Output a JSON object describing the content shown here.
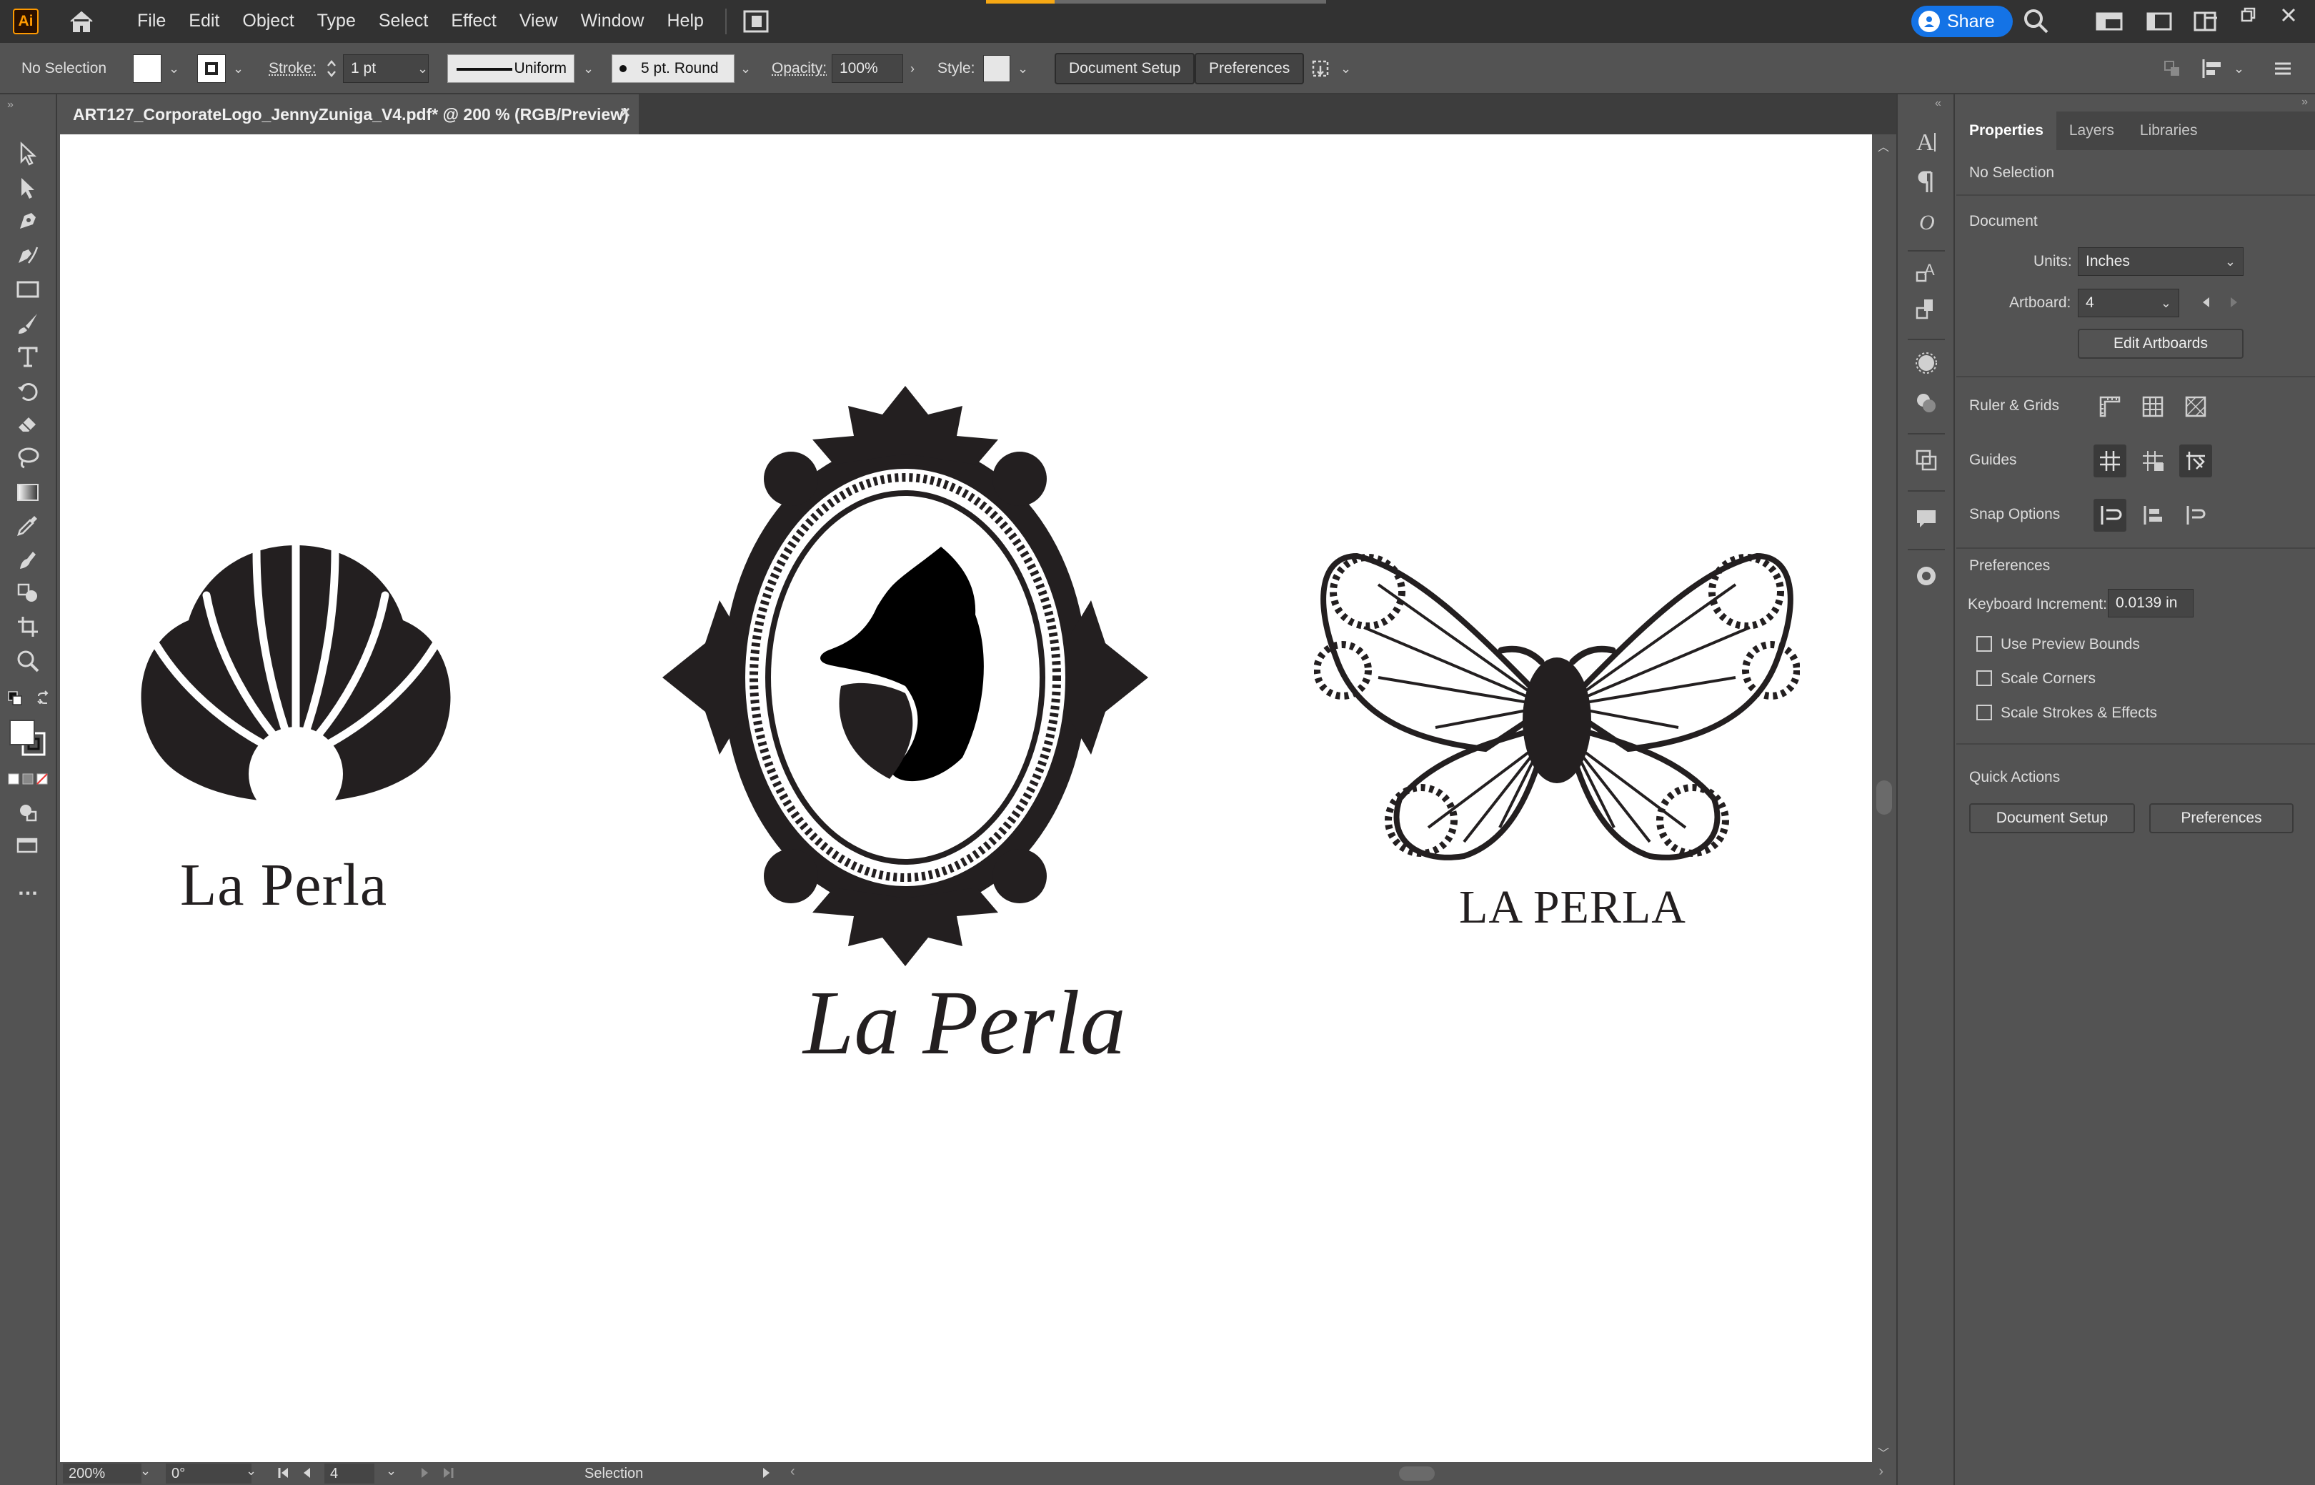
{
  "app": {
    "logo": "Ai",
    "accent": "#ff9a00"
  },
  "menu": [
    "File",
    "Edit",
    "Object",
    "Type",
    "Select",
    "Effect",
    "View",
    "Window",
    "Help"
  ],
  "share_label": "Share",
  "control": {
    "selection": "No Selection",
    "stroke_label": "Stroke:",
    "stroke_weight": "1 pt",
    "stroke_profile": "Uniform",
    "brush": "5 pt. Round",
    "opacity_label": "Opacity:",
    "opacity": "100%",
    "style_label": "Style:",
    "document_setup": "Document Setup",
    "preferences": "Preferences"
  },
  "document": {
    "tab_title": "ART127_CorporateLogo_JennyZuniga_V4.pdf* @ 200 % (RGB/Preview)",
    "close": "×"
  },
  "artwork": {
    "logo1_text": "La Perla",
    "logo2_text": "La Perla",
    "logo3_text": "LA PERLA"
  },
  "status": {
    "zoom": "200%",
    "rotation": "0°",
    "artboard": "4",
    "tool": "Selection"
  },
  "panel": {
    "tabs": [
      "Properties",
      "Layers",
      "Libraries"
    ],
    "active_tab": "Properties",
    "selection": "No Selection",
    "document_heading": "Document",
    "units_label": "Units:",
    "units_value": "Inches",
    "artboard_label": "Artboard:",
    "artboard_value": "4",
    "edit_artboards": "Edit Artboards",
    "ruler_grids": "Ruler & Grids",
    "guides": "Guides",
    "snap_options": "Snap Options",
    "preferences_heading": "Preferences",
    "keyboard_increment_label": "Keyboard Increment:",
    "keyboard_increment_value": "0.0139 in",
    "checkboxes": [
      "Use Preview Bounds",
      "Scale Corners",
      "Scale Strokes & Effects"
    ],
    "quick_actions": "Quick Actions",
    "document_setup": "Document Setup",
    "preferences": "Preferences"
  }
}
